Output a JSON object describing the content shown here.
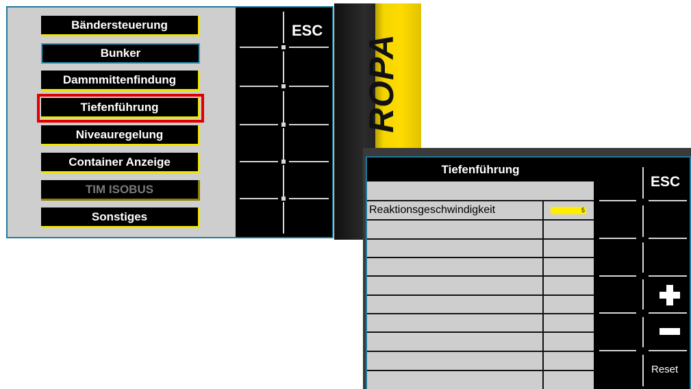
{
  "screen1": {
    "menu_items": [
      {
        "label": "Bändersteuerung"
      },
      {
        "label": "Bunker"
      },
      {
        "label": "Dammmittenfindung"
      },
      {
        "label": "Tiefenführung",
        "selected": true
      },
      {
        "label": "Niveauregelung"
      },
      {
        "label": "Container Anzeige"
      },
      {
        "label": "TIM ISOBUS",
        "disabled": true
      },
      {
        "label": "Sonstiges"
      }
    ],
    "softkeys": {
      "esc_label": "ESC"
    }
  },
  "brand": {
    "logo_text": "ROPA"
  },
  "screen2": {
    "title": "Tiefenführung",
    "parameters": [
      {
        "name": "Reaktionsgeschwindigkeit",
        "value": "5"
      }
    ],
    "softkeys": {
      "esc_label": "ESC",
      "plus_icon": "plus-icon",
      "minus_icon": "minus-icon",
      "reset_label": "Reset"
    }
  },
  "colors": {
    "panel_grey": "#cecece",
    "accent_yellow": "#f2e600",
    "selection_red": "#e00000",
    "frame_blue": "#1f7a9b",
    "ropa_yellow": "#ffdc00"
  }
}
